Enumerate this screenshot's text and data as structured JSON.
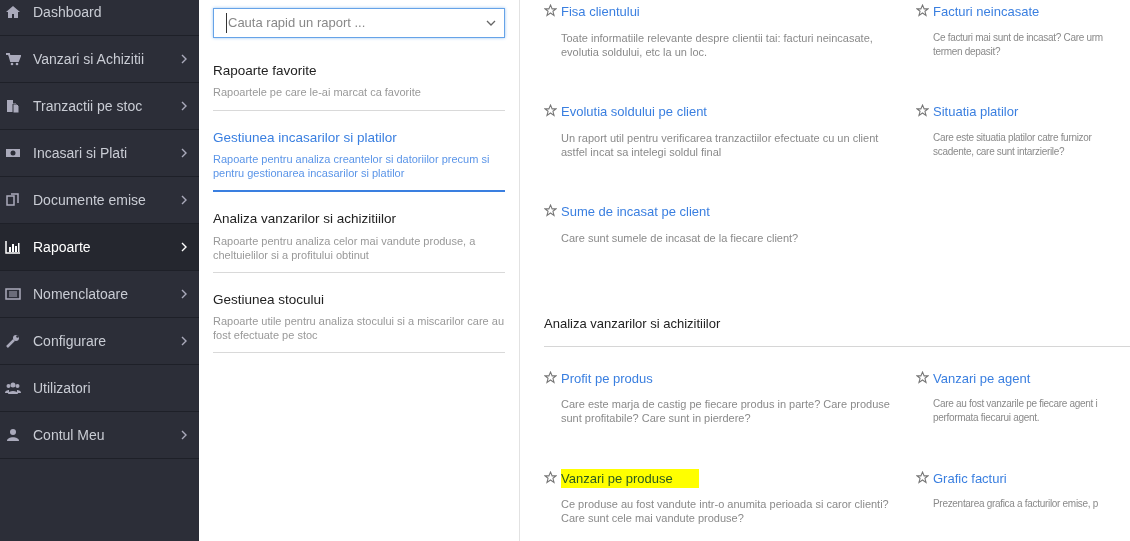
{
  "sidebar": {
    "items": [
      {
        "label": "Dashboard",
        "has_submenu": false,
        "selected": false
      },
      {
        "label": "Vanzari si Achizitii",
        "has_submenu": true,
        "selected": false
      },
      {
        "label": "Tranzactii pe stoc",
        "has_submenu": true,
        "selected": false
      },
      {
        "label": "Incasari si Plati",
        "has_submenu": true,
        "selected": false
      },
      {
        "label": "Documente emise",
        "has_submenu": true,
        "selected": false
      },
      {
        "label": "Rapoarte",
        "has_submenu": true,
        "selected": true
      },
      {
        "label": "Nomenclatoare",
        "has_submenu": true,
        "selected": false
      },
      {
        "label": "Configurare",
        "has_submenu": true,
        "selected": false
      },
      {
        "label": "Utilizatori",
        "has_submenu": false,
        "selected": false
      },
      {
        "label": "Contul Meu",
        "has_submenu": true,
        "selected": false
      }
    ]
  },
  "search": {
    "placeholder": "Cauta rapid un raport ..."
  },
  "categories": [
    {
      "title": "Rapoarte favorite",
      "description": "Rapoartele pe care le-ai marcat ca favorite",
      "selected": false
    },
    {
      "title": "Gestiunea incasarilor si platilor",
      "description": "Rapoarte pentru analiza creantelor si datoriilor precum si pentru gestionarea incasarilor si platilor",
      "selected": true
    },
    {
      "title": "Analiza vanzarilor si achizitiilor",
      "description": "Rapoarte pentru analiza celor mai vandute produse, a cheltuielilor si a profitului obtinut",
      "selected": false
    },
    {
      "title": "Gestiunea stocului",
      "description": "Rapoarte utile pentru analiza stocului si a miscarilor care au fost efectuate pe stoc",
      "selected": false
    }
  ],
  "sections": [
    {
      "reports": [
        {
          "title": "Fisa clientului",
          "description": "Toate informatiile relevante despre clientii tai: facturi neincasate,\nevolutia soldului, etc la un loc.",
          "highlighted": false
        },
        {
          "title": "Facturi neincasate",
          "description": "Ce facturi mai sunt de incasat? Care urm\ntermen depasit?",
          "highlighted": false
        },
        {
          "title": "Evolutia soldului pe client",
          "description": "Un raport util pentru verificarea tranzactiilor efectuate cu un client\nastfel incat sa intelegi soldul final",
          "highlighted": false
        },
        {
          "title": "Situatia platilor",
          "description": "Care este situatia platilor catre furnizor\nscadente, care sunt intarzierile?",
          "highlighted": false
        },
        {
          "title": "Sume de incasat pe client",
          "description": "Care sunt sumele de incasat de la fiecare client?",
          "highlighted": false
        }
      ]
    },
    {
      "heading": "Analiza vanzarilor si achizitiilor",
      "reports": [
        {
          "title": "Profit pe produs",
          "description": "Care este marja de castig pe fiecare produs in parte? Care produse\nsunt profitabile? Care sunt in pierdere?",
          "highlighted": false
        },
        {
          "title": "Vanzari pe agent",
          "description": "Care au fost vanzarile pe fiecare agent i\nperformata fiecarui agent.",
          "highlighted": false
        },
        {
          "title": "Vanzari pe produse",
          "description": "Ce produse au fost vandute intr-o anumita perioada si caror clienti?\nCare sunt cele mai vandute produse?",
          "highlighted": true
        },
        {
          "title": "Grafic facturi",
          "description": "Prezentarea grafica a facturilor emise, p",
          "highlighted": false
        }
      ]
    }
  ]
}
